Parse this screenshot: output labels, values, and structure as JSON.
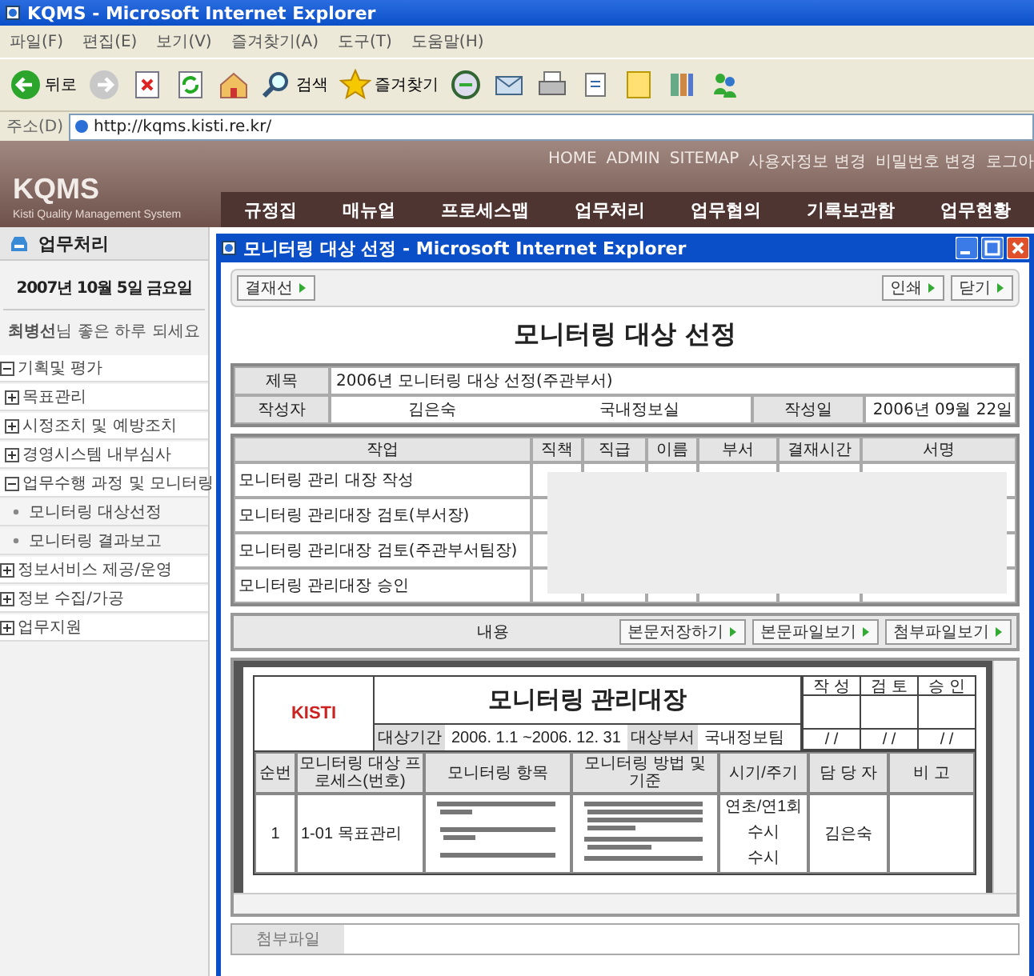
{
  "browser": {
    "title": "KQMS - Microsoft Internet Explorer",
    "menu": [
      "파일(F)",
      "편집(E)",
      "보기(V)",
      "즐겨찾기(A)",
      "도구(T)",
      "도움말(H)"
    ],
    "toolbar": [
      {
        "kind": "back",
        "label": "뒤로"
      },
      {
        "kind": "forward"
      },
      {
        "kind": "stop"
      },
      {
        "kind": "refresh"
      },
      {
        "kind": "home"
      },
      {
        "kind": "search",
        "label": "검색"
      },
      {
        "kind": "favorites",
        "label": "즐겨찾기"
      },
      {
        "kind": "media"
      },
      {
        "kind": "mail"
      },
      {
        "kind": "print"
      },
      {
        "kind": "edit"
      },
      {
        "kind": "note"
      },
      {
        "kind": "research"
      },
      {
        "kind": "messenger"
      }
    ],
    "address_label": "주소(D)",
    "address": "http://kqms.kisti.re.kr/"
  },
  "site": {
    "logo": "KQMS",
    "subtitle": "Kisti Quality Management System",
    "top_links": [
      "HOME",
      "ADMIN",
      "SITEMAP",
      "사용자정보 변경",
      "비밀번호 변경",
      "로그아"
    ],
    "nav": [
      "규정집",
      "매뉴얼",
      "프로세스맵",
      "업무처리",
      "업무협의",
      "기록보관함",
      "업무현황"
    ]
  },
  "sidebar": {
    "heading": "업무처리",
    "date": "2007년 10월 5일 금요일",
    "greeting": "**최병선**님 좋은 하루 되세요",
    "tree": [
      {
        "kind": "folder",
        "label": "기획및 평가",
        "expanded": true,
        "children": [
          {
            "kind": "folder",
            "label": "목표관리",
            "expanded": false
          },
          {
            "kind": "folder",
            "label": "시정조치 및 예방조치",
            "expanded": false
          },
          {
            "kind": "folder",
            "label": "경영시스템 내부심사",
            "expanded": false
          },
          {
            "kind": "folder",
            "label": "업무수행 과정 및 모니터링",
            "expanded": true,
            "children": [
              {
                "kind": "page",
                "label": "모니터링 대상선정"
              },
              {
                "kind": "page",
                "label": "모니터링 결과보고"
              }
            ]
          }
        ]
      },
      {
        "kind": "folder",
        "label": "정보서비스 제공/운영",
        "expanded": false
      },
      {
        "kind": "folder",
        "label": "정보 수집/가공",
        "expanded": false
      },
      {
        "kind": "folder",
        "label": "업무지원",
        "expanded": false
      }
    ]
  },
  "popup": {
    "title": "모니터링 대상 선정 - Microsoft Internet Explorer",
    "left_buttons": [
      "결재선"
    ],
    "right_buttons": [
      "인쇄",
      "닫기"
    ],
    "heading": "모니터링 대상 선정",
    "info": {
      "subject_label": "제목",
      "subject": "2006년 모니터링 대상 선정(주관부서)",
      "author_label": "작성자",
      "author": "김은숙",
      "department": "국내정보실",
      "date_label": "작성일",
      "date": "2006년 09월 22일"
    },
    "approval": {
      "columns": [
        "작업",
        "직책",
        "직급",
        "이름",
        "부서",
        "결재시간",
        "서명"
      ],
      "rows": [
        "모니터링 관리 대장 작성",
        "모니터링 관리대장 검토(부서장)",
        "모니터링 관리대장 검토(주관부서팀장)",
        "모니터링 관리대장 승인"
      ]
    },
    "content_label": "내용",
    "content_buttons": [
      "본문저장하기",
      "본문파일보기",
      "첨부파일보기"
    ],
    "document": {
      "logo": "KISTI",
      "title": "모니터링 관리대장",
      "period_label": "대상기간",
      "period": "2006. 1.1 ~2006. 12. 31",
      "dept_label": "대상부서",
      "dept": "국내정보팀",
      "sign_columns": [
        "작 성",
        "검 토",
        "승 인"
      ],
      "sign_dates": [
        "/ /",
        "/ /",
        "/ /"
      ],
      "columns": [
        "순번",
        "모니터링 대상 프로세스(번호)",
        "모니터링 항목",
        "모니터링 방법 및 기준",
        "시기/주기",
        "담 당 자",
        "비 고"
      ],
      "row": {
        "no": "1",
        "process": "1-01 목표관리",
        "timing": [
          "연초/연1회",
          "수시",
          "수시"
        ],
        "owner": "김은숙"
      }
    },
    "attachment_label": "첨부파일"
  }
}
